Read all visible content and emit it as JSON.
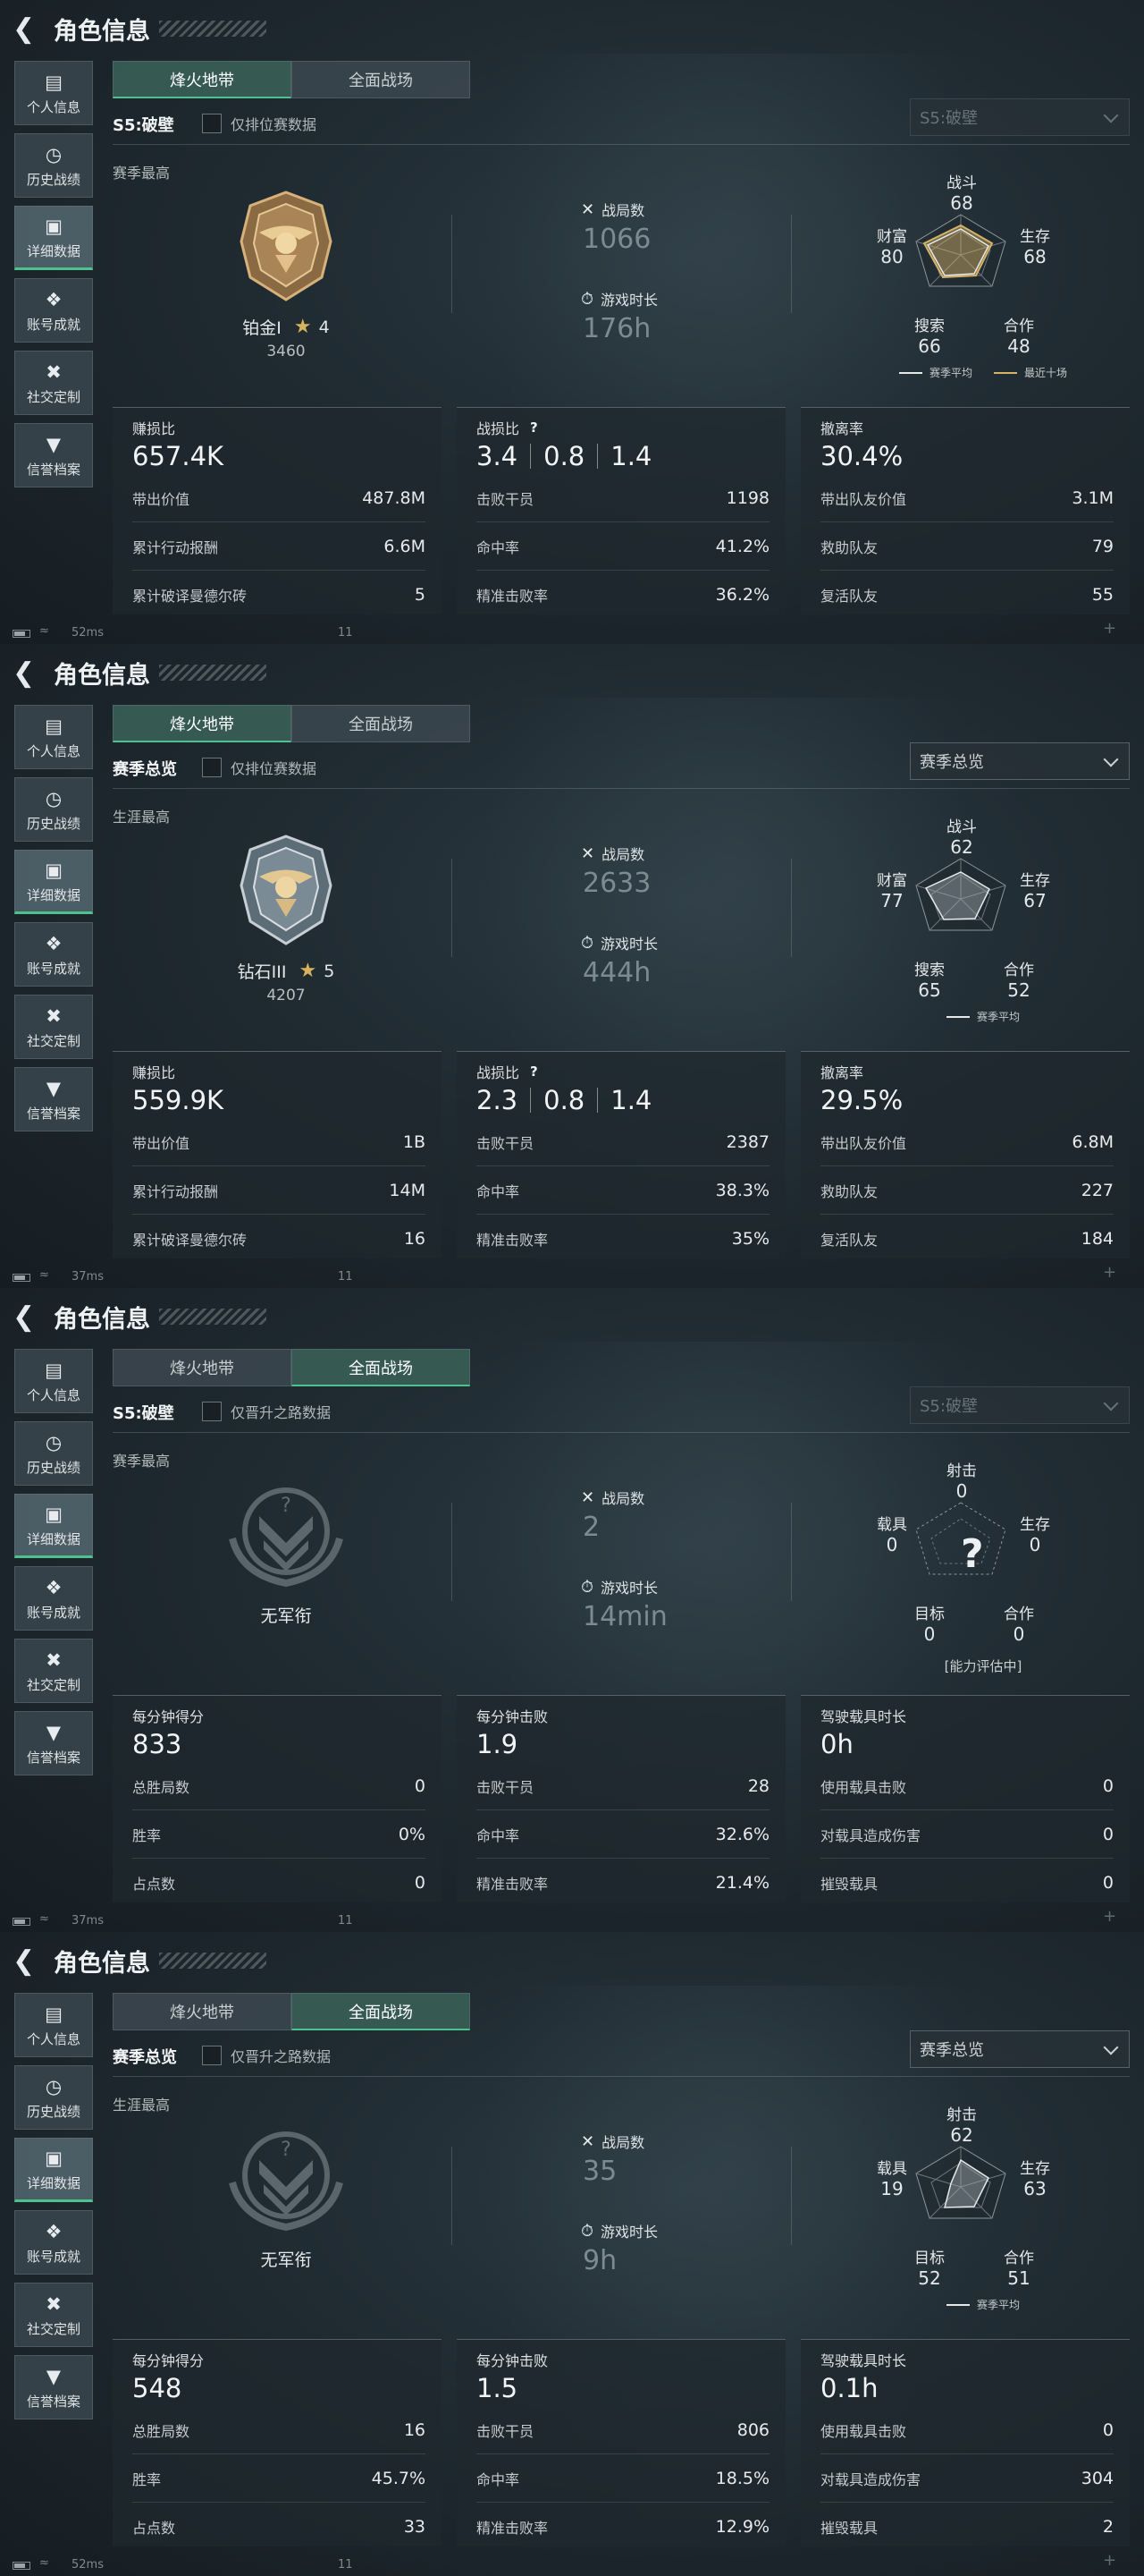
{
  "panels": [
    {
      "header": {
        "title": "角色信息"
      },
      "sidebar": [
        "个人信息",
        "历史战绩",
        "详细数据",
        "账号成就",
        "社交定制",
        "信誉档案"
      ],
      "tabs": [
        "烽火地带",
        "全面战场"
      ],
      "season_label": "S5:破壁",
      "checkbox_label": "仅排位赛数据",
      "select_value": "S5:破壁",
      "best_label": "赛季最高",
      "rank": {
        "name": "铂金I",
        "stars": "4",
        "points": "3460"
      },
      "stats": {
        "matches_label": "战局数",
        "matches": "1066",
        "time_label": "游戏时长",
        "time": "176h"
      },
      "radar": {
        "top": [
          "战斗",
          "68"
        ],
        "right": [
          "生存",
          "68"
        ],
        "bottomRight": [
          "合作",
          "48"
        ],
        "bottomLeft": [
          "搜索",
          "66"
        ],
        "left": [
          "财富",
          "80"
        ]
      },
      "legend": {
        "avg": "赛季平均",
        "recent": "最近十场"
      },
      "cards": [
        {
          "title": "赚损比",
          "value": "657.4K",
          "rows": [
            [
              "带出价值",
              "487.8M"
            ],
            [
              "累计行动报酬",
              "6.6M"
            ],
            [
              "累计破译曼德尔砖",
              "5"
            ]
          ]
        },
        {
          "title": "战损比",
          "q": "?",
          "values": [
            "3.4",
            "0.8",
            "1.4"
          ],
          "rows": [
            [
              "击败干员",
              "1198"
            ],
            [
              "命中率",
              "41.2%"
            ],
            [
              "精准击败率",
              "36.2%"
            ]
          ]
        },
        {
          "title": "撤离率",
          "value": "30.4%",
          "rows": [
            [
              "带出队友价值",
              "3.1M"
            ],
            [
              "救助队友",
              "79"
            ],
            [
              "复活队友",
              "55"
            ]
          ]
        }
      ],
      "status": {
        "ping": "52ms",
        "page": "11"
      }
    },
    {
      "header": {
        "title": "角色信息"
      },
      "sidebar": [
        "个人信息",
        "历史战绩",
        "详细数据",
        "账号成就",
        "社交定制",
        "信誉档案"
      ],
      "tabs": [
        "烽火地带",
        "全面战场"
      ],
      "season_label": "赛季总览",
      "checkbox_label": "仅排位赛数据",
      "select_value": "赛季总览",
      "best_label": "生涯最高",
      "rank": {
        "name": "钻石III",
        "stars": "5",
        "points": "4207"
      },
      "stats": {
        "matches_label": "战局数",
        "matches": "2633",
        "time_label": "游戏时长",
        "time": "444h"
      },
      "radar": {
        "top": [
          "战斗",
          "62"
        ],
        "right": [
          "生存",
          "67"
        ],
        "bottomRight": [
          "合作",
          "52"
        ],
        "bottomLeft": [
          "搜索",
          "65"
        ],
        "left": [
          "财富",
          "77"
        ]
      },
      "legend": {
        "avg": "赛季平均"
      },
      "cards": [
        {
          "title": "赚损比",
          "value": "559.9K",
          "rows": [
            [
              "带出价值",
              "1B"
            ],
            [
              "累计行动报酬",
              "14M"
            ],
            [
              "累计破译曼德尔砖",
              "16"
            ]
          ]
        },
        {
          "title": "战损比",
          "q": "?",
          "values": [
            "2.3",
            "0.8",
            "1.4"
          ],
          "rows": [
            [
              "击败干员",
              "2387"
            ],
            [
              "命中率",
              "38.3%"
            ],
            [
              "精准击败率",
              "35%"
            ]
          ]
        },
        {
          "title": "撤离率",
          "value": "29.5%",
          "rows": [
            [
              "带出队友价值",
              "6.8M"
            ],
            [
              "救助队友",
              "227"
            ],
            [
              "复活队友",
              "184"
            ]
          ]
        }
      ],
      "status": {
        "ping": "37ms",
        "page": "11"
      }
    },
    {
      "header": {
        "title": "角色信息"
      },
      "sidebar": [
        "个人信息",
        "历史战绩",
        "详细数据",
        "账号成就",
        "社交定制",
        "信誉档案"
      ],
      "tabs": [
        "烽火地带",
        "全面战场"
      ],
      "season_label": "S5:破壁",
      "checkbox_label": "仅晋升之路数据",
      "select_value": "S5:破壁",
      "best_label": "赛季最高",
      "rank": {
        "name": "无军衔"
      },
      "stats": {
        "matches_label": "战局数",
        "matches": "2",
        "time_label": "游戏时长",
        "time": "14min"
      },
      "radar": {
        "top": [
          "射击",
          "0"
        ],
        "right": [
          "生存",
          "0"
        ],
        "bottomRight": [
          "合作",
          "0"
        ],
        "bottomLeft": [
          "目标",
          "0"
        ],
        "left": [
          "载具",
          "0"
        ]
      },
      "eval_note": "[能力评估中]",
      "cards": [
        {
          "title": "每分钟得分",
          "value": "833",
          "rows": [
            [
              "总胜局数",
              "0"
            ],
            [
              "胜率",
              "0%"
            ],
            [
              "占点数",
              "0"
            ]
          ]
        },
        {
          "title": "每分钟击败",
          "value": "1.9",
          "rows": [
            [
              "击败干员",
              "28"
            ],
            [
              "命中率",
              "32.6%"
            ],
            [
              "精准击败率",
              "21.4%"
            ]
          ]
        },
        {
          "title": "驾驶载具时长",
          "value": "0h",
          "rows": [
            [
              "使用载具击败",
              "0"
            ],
            [
              "对载具造成伤害",
              "0"
            ],
            [
              "摧毁载具",
              "0"
            ]
          ]
        }
      ],
      "status": {
        "ping": "37ms",
        "page": "11"
      }
    },
    {
      "header": {
        "title": "角色信息"
      },
      "sidebar": [
        "个人信息",
        "历史战绩",
        "详细数据",
        "账号成就",
        "社交定制",
        "信誉档案"
      ],
      "tabs": [
        "烽火地带",
        "全面战场"
      ],
      "season_label": "赛季总览",
      "checkbox_label": "仅晋升之路数据",
      "select_value": "赛季总览",
      "best_label": "生涯最高",
      "rank": {
        "name": "无军衔"
      },
      "stats": {
        "matches_label": "战局数",
        "matches": "35",
        "time_label": "游戏时长",
        "time": "9h"
      },
      "radar": {
        "top": [
          "射击",
          "62"
        ],
        "right": [
          "生存",
          "63"
        ],
        "bottomRight": [
          "合作",
          "51"
        ],
        "bottomLeft": [
          "目标",
          "52"
        ],
        "left": [
          "载具",
          "19"
        ]
      },
      "legend": {
        "avg": "赛季平均"
      },
      "cards": [
        {
          "title": "每分钟得分",
          "value": "548",
          "rows": [
            [
              "总胜局数",
              "16"
            ],
            [
              "胜率",
              "45.7%"
            ],
            [
              "占点数",
              "33"
            ]
          ]
        },
        {
          "title": "每分钟击败",
          "value": "1.5",
          "rows": [
            [
              "击败干员",
              "806"
            ],
            [
              "命中率",
              "18.5%"
            ],
            [
              "精准击败率",
              "12.9%"
            ]
          ]
        },
        {
          "title": "驾驶载具时长",
          "value": "0.1h",
          "rows": [
            [
              "使用载具击败",
              "0"
            ],
            [
              "对载具造成伤害",
              "304"
            ],
            [
              "摧毁载具",
              "2"
            ]
          ]
        }
      ],
      "status": {
        "ping": "52ms",
        "page": "11"
      }
    }
  ]
}
